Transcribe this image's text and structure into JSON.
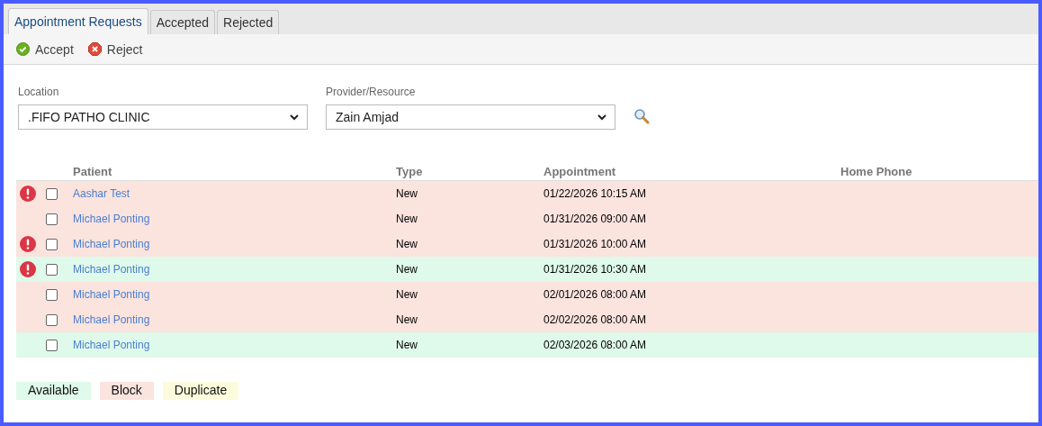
{
  "tabs": [
    {
      "label": "Appointment Requests",
      "selected": true
    },
    {
      "label": "Accepted",
      "selected": false
    },
    {
      "label": "Rejected",
      "selected": false
    }
  ],
  "toolbar": [
    {
      "kind": "accept",
      "label": "Accept"
    },
    {
      "kind": "reject",
      "label": "Reject"
    }
  ],
  "filters": [
    {
      "label": "Location",
      "value": ".FIFO PATHO CLINIC"
    },
    {
      "label": "Provider/Resource",
      "value": "Zain Amjad"
    }
  ],
  "table": {
    "columns": [
      "Patient",
      "Type",
      "Appointment",
      "Home Phone"
    ],
    "rows": [
      {
        "alert": true,
        "checked": false,
        "patient": "Aashar Test",
        "type": "New",
        "appointment": "01/22/2026 10:15 AM",
        "color": "#fbe3de"
      },
      {
        "alert": false,
        "checked": false,
        "patient": "Michael Ponting",
        "type": "New",
        "appointment": "01/31/2026 09:00 AM",
        "color": "#fbe3de"
      },
      {
        "alert": true,
        "checked": false,
        "patient": "Michael Ponting",
        "type": "New",
        "appointment": "01/31/2026 10:00 AM",
        "color": "#fbe3de"
      },
      {
        "alert": true,
        "checked": false,
        "patient": "Michael Ponting",
        "type": "New",
        "appointment": "01/31/2026 10:30 AM",
        "color": "#dffaea"
      },
      {
        "alert": false,
        "checked": false,
        "patient": "Michael Ponting",
        "type": "New",
        "appointment": "02/01/2026 08:00 AM",
        "color": "#fbe3de"
      },
      {
        "alert": false,
        "checked": false,
        "patient": "Michael Ponting",
        "type": "New",
        "appointment": "02/02/2026 08:00 AM",
        "color": "#fbe3de"
      },
      {
        "alert": false,
        "checked": false,
        "patient": "Michael Ponting",
        "type": "New",
        "appointment": "02/03/2026 08:00 AM",
        "color": "#dffaea"
      }
    ]
  },
  "legend": [
    {
      "label": "Available",
      "color": "#dffaea"
    },
    {
      "label": "Block",
      "color": "#fbe3de"
    },
    {
      "label": "Duplicate",
      "color": "#fcfcdc"
    }
  ]
}
